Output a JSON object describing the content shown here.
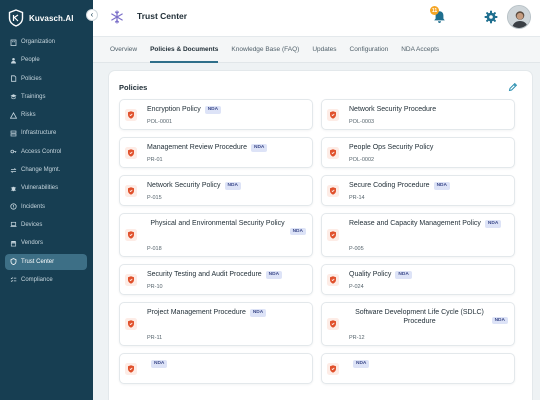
{
  "brand": {
    "name": "Kuvasch.AI"
  },
  "header": {
    "title": "Trust Center",
    "notification_count": "11"
  },
  "sidebar": {
    "items": [
      {
        "label": "Organization",
        "icon": "building-icon",
        "active": false
      },
      {
        "label": "People",
        "icon": "people-icon",
        "active": false
      },
      {
        "label": "Policies",
        "icon": "document-icon",
        "active": false
      },
      {
        "label": "Trainings",
        "icon": "graduation-icon",
        "active": false
      },
      {
        "label": "Risks",
        "icon": "warning-icon",
        "active": false
      },
      {
        "label": "Infrastructure",
        "icon": "server-icon",
        "active": false
      },
      {
        "label": "Access Control",
        "icon": "key-icon",
        "active": false
      },
      {
        "label": "Change Mgmt.",
        "icon": "change-icon",
        "active": false
      },
      {
        "label": "Vulnerabilities",
        "icon": "bug-icon",
        "active": false
      },
      {
        "label": "Incidents",
        "icon": "alert-icon",
        "active": false
      },
      {
        "label": "Devices",
        "icon": "laptop-icon",
        "active": false
      },
      {
        "label": "Vendors",
        "icon": "store-icon",
        "active": false
      },
      {
        "label": "Trust Center",
        "icon": "shield-icon",
        "active": true
      },
      {
        "label": "Compliance",
        "icon": "checklist-icon",
        "active": false
      }
    ]
  },
  "tabs": [
    {
      "label": "Overview",
      "active": false
    },
    {
      "label": "Policies & Documents",
      "active": true
    },
    {
      "label": "Knowledge Base (FAQ)",
      "active": false
    },
    {
      "label": "Updates",
      "active": false
    },
    {
      "label": "Configuration",
      "active": false
    },
    {
      "label": "NDA Accepts",
      "active": false
    }
  ],
  "policies_section": {
    "title": "Policies",
    "nda_label": "NDA",
    "items": [
      {
        "title": "Encryption Policy",
        "code": "POL-0001",
        "nda": true,
        "layout": "inline"
      },
      {
        "title": "Network Security Procedure",
        "code": "POL-0003",
        "nda": false,
        "layout": "inline"
      },
      {
        "title": "Management Review Procedure",
        "code": "PR-01",
        "nda": true,
        "layout": "inline"
      },
      {
        "title": "People Ops Security Policy",
        "code": "POL-0002",
        "nda": false,
        "layout": "inline"
      },
      {
        "title": "Network Security Policy",
        "code": "P-015",
        "nda": true,
        "layout": "inline"
      },
      {
        "title": "Secure Coding Procedure",
        "code": "PR-14",
        "nda": true,
        "layout": "inline"
      },
      {
        "title": "Physical and Environmental Security Policy",
        "code": "P-018",
        "nda": true,
        "layout": "centered"
      },
      {
        "title": "Release and Capacity Management Policy",
        "code": "P-005",
        "nda": true,
        "layout": "inline"
      },
      {
        "title": "Security Testing and Audit Procedure",
        "code": "PR-10",
        "nda": true,
        "layout": "inline"
      },
      {
        "title": "Quality Policy",
        "code": "P-024",
        "nda": true,
        "layout": "inline"
      },
      {
        "title": "Project Management Procedure",
        "code": "PR-11",
        "nda": true,
        "layout": "inline"
      },
      {
        "title": "Software Development Life Cycle (SDLC) Procedure",
        "code": "PR-12",
        "nda": true,
        "layout": "centered"
      },
      {
        "title": "",
        "code": "",
        "nda": true,
        "layout": "inline"
      },
      {
        "title": "",
        "code": "",
        "nda": true,
        "layout": "inline"
      }
    ]
  },
  "colors": {
    "sidebar_bg": "#173e52",
    "sidebar_active": "#3d6f86",
    "accent": "#2f6f8a",
    "doc_icon": "#e0502b",
    "nda_badge_bg": "#dde3f7",
    "bell": "#f5a524"
  }
}
